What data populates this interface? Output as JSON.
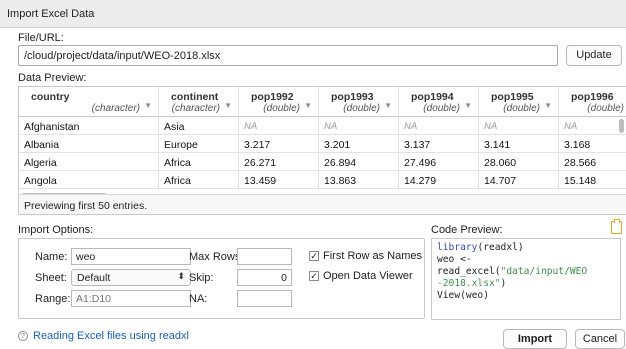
{
  "window": {
    "title": "Import Excel Data"
  },
  "file": {
    "label": "File/URL:",
    "value": "/cloud/project/data/input/WEO-2018.xlsx",
    "update_label": "Update"
  },
  "preview": {
    "label": "Data Preview:",
    "columns": [
      {
        "name": "country",
        "type": "(character)"
      },
      {
        "name": "continent",
        "type": "(character)"
      },
      {
        "name": "pop1992",
        "type": "(double)"
      },
      {
        "name": "pop1993",
        "type": "(double)"
      },
      {
        "name": "pop1994",
        "type": "(double)"
      },
      {
        "name": "pop1995",
        "type": "(double)"
      },
      {
        "name": "pop1996",
        "type": "(double)"
      }
    ],
    "rows": [
      [
        "Afghanistan",
        "Asia",
        "NA",
        "NA",
        "NA",
        "NA",
        "NA"
      ],
      [
        "Albania",
        "Europe",
        "3.217",
        "3.201",
        "3.137",
        "3.141",
        "3.168"
      ],
      [
        "Algeria",
        "Africa",
        "26.271",
        "26.894",
        "27.496",
        "28.060",
        "28.566"
      ],
      [
        "Angola",
        "Africa",
        "13.459",
        "13.863",
        "14.279",
        "14.707",
        "15.148"
      ]
    ],
    "footer": "Previewing first 50 entries."
  },
  "options": {
    "label": "Import Options:",
    "name_label": "Name:",
    "name_value": "weo",
    "sheet_label": "Sheet:",
    "sheet_value": "Default",
    "range_label": "Range:",
    "range_placeholder": "A1:D10",
    "maxrows_label": "Max Rows:",
    "maxrows_value": "",
    "skip_label": "Skip:",
    "skip_value": "0",
    "na_label": "NA:",
    "na_value": "",
    "first_row_label": "First Row as Names",
    "first_row_checked": true,
    "open_viewer_label": "Open Data Viewer",
    "open_viewer_checked": true
  },
  "code": {
    "label": "Code Preview:",
    "line1_fn": "library",
    "line1_rest": "(readxl)",
    "line2_a": "weo <- read_excel(",
    "line2_str": "\"data/input/WEO",
    "line3_str": "-2018.xlsx\"",
    "line3_rest": ")",
    "line4": "View(weo)"
  },
  "footer": {
    "help_link": "Reading Excel files using readxl",
    "import_label": "Import",
    "cancel_label": "Cancel"
  },
  "icons": {
    "help": "help-circle-icon",
    "clipboard": "clipboard-icon",
    "sort": "sort-arrow-icon",
    "check": "checkmark-icon",
    "select": "select-arrows-icon"
  },
  "colors": {
    "link": "#1d5fb4",
    "code_function": "#2f4fa8",
    "code_string": "#3f8f4f",
    "clipboard": "#e4a32c"
  }
}
